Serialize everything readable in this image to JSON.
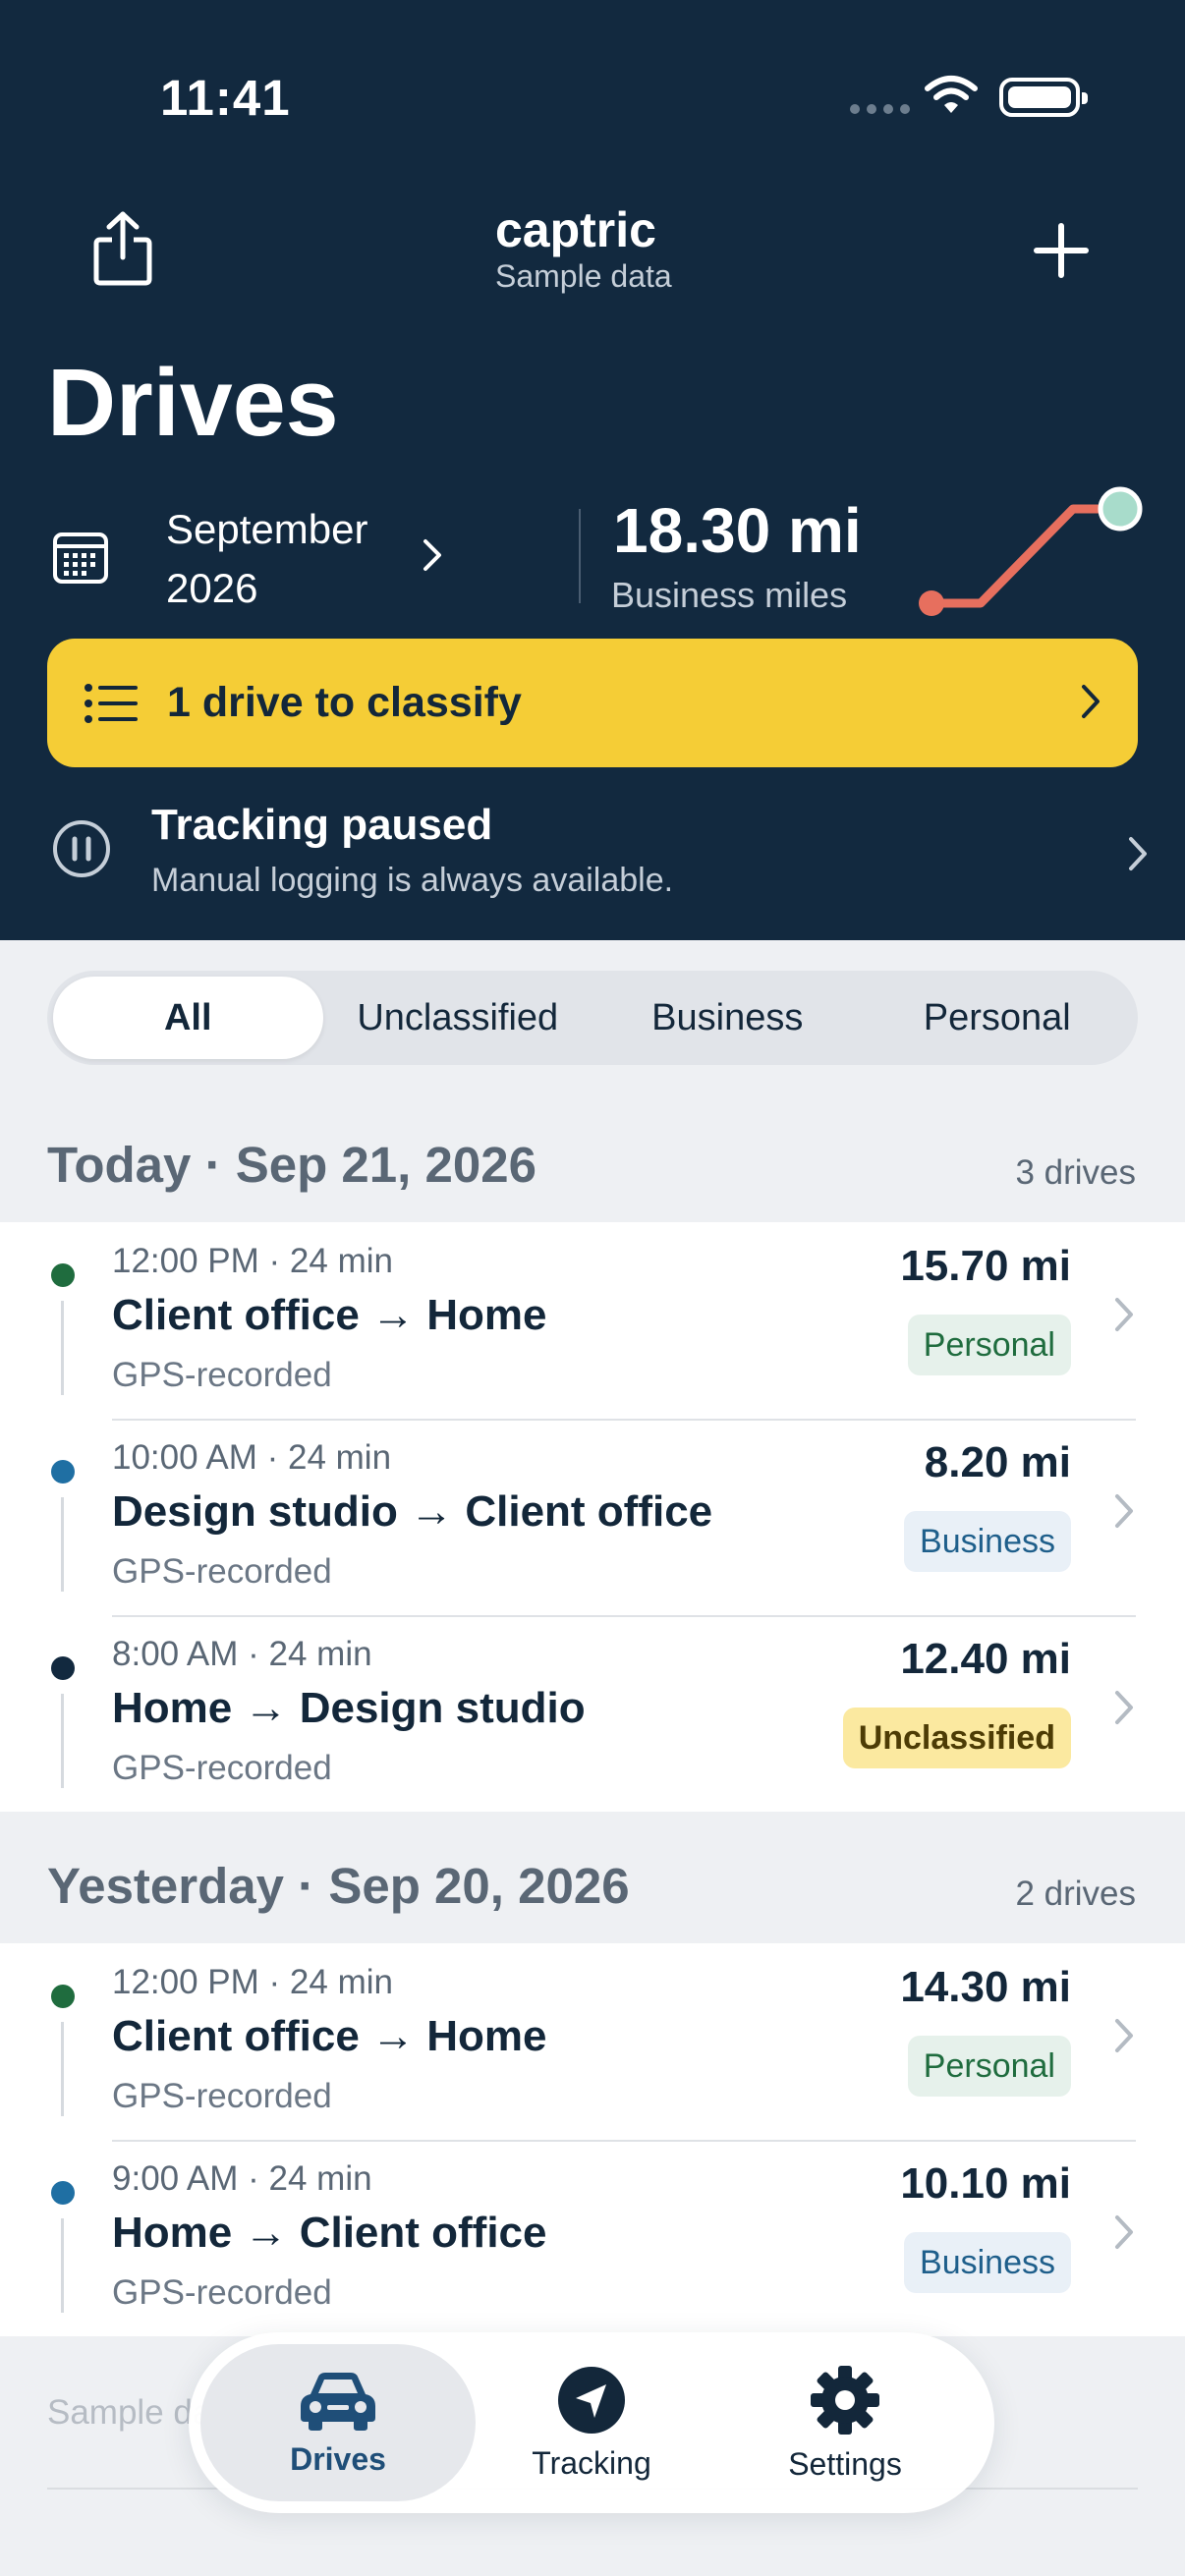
{
  "status_bar": {
    "time": "11:41"
  },
  "header": {
    "brand": "captric",
    "subtitle": "Sample data",
    "page_title": "Drives",
    "month_label": "September\n2026",
    "business_miles": "18.30 mi",
    "business_miles_label": "Business miles"
  },
  "classify_banner": {
    "label": "1 drive to classify"
  },
  "tracking": {
    "title": "Tracking paused",
    "subtitle": "Manual logging is always available."
  },
  "filters": [
    "All",
    "Unclassified",
    "Business",
    "Personal"
  ],
  "sections": [
    {
      "title": "Today · Sep 21, 2026",
      "count": "3 drives",
      "drives": [
        {
          "time": "12:00 PM  · 24 min",
          "route": "Client office → Home",
          "source": "GPS-recorded",
          "miles": "15.70 mi",
          "category": "Personal"
        },
        {
          "time": "10:00 AM  · 24 min",
          "route": "Design studio → Client office",
          "source": "GPS-recorded",
          "miles": "8.20 mi",
          "category": "Business"
        },
        {
          "time": "8:00 AM  · 24 min",
          "route": "Home → Design studio",
          "source": "GPS-recorded",
          "miles": "12.40 mi",
          "category": "Unclassified"
        }
      ]
    },
    {
      "title": "Yesterday · Sep 20, 2026",
      "count": "2 drives",
      "drives": [
        {
          "time": "12:00 PM  · 24 min",
          "route": "Client office → Home",
          "source": "GPS-recorded",
          "miles": "14.30 mi",
          "category": "Personal"
        },
        {
          "time": "9:00 AM  · 24 min",
          "route": "Home → Client office",
          "source": "GPS-recorded",
          "miles": "10.10 mi",
          "category": "Business"
        }
      ]
    }
  ],
  "footer_note": "Sample data",
  "tabs": [
    {
      "label": "Drives",
      "icon": "car-icon"
    },
    {
      "label": "Tracking",
      "icon": "navigation-icon"
    },
    {
      "label": "Settings",
      "icon": "gear-icon"
    }
  ],
  "colors": {
    "header_bg": "#12293f",
    "banner": "#f5cd36",
    "personal_dot": "#1f6c3e",
    "business_dot": "#1f6fa3",
    "unclassified_dot": "#12293f",
    "sparkline": "#e76f5e",
    "sparkline_end": "#a8dccb"
  }
}
